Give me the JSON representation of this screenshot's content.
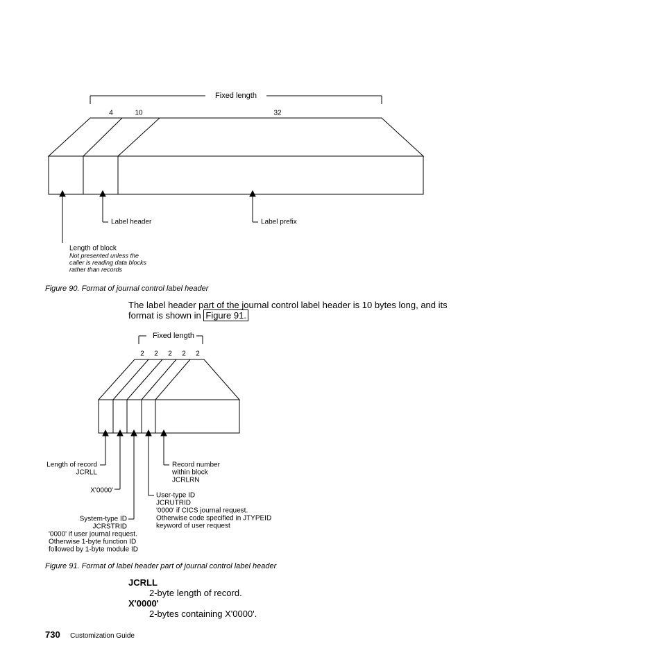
{
  "fig90": {
    "bracket_label": "Fixed length",
    "top_numbers": [
      "4",
      "10",
      "32"
    ],
    "label_header": "Label header",
    "label_prefix": "Label prefix",
    "length_of_block": "Length of block",
    "note1": "Not presented unless the",
    "note2": "caller is reading data blocks",
    "note3": "rather than records",
    "caption": "Figure 90. Format of journal control label header"
  },
  "para": {
    "line1_a": "The label header part of the journal control label header is 10 bytes long, and its",
    "line2_a": "format is shown in ",
    "line2_link": "Figure 91."
  },
  "fig91": {
    "bracket_label": "Fixed length",
    "top_numbers": [
      "2",
      "2",
      "2",
      "2",
      "2"
    ],
    "len_rec1": "Length of record",
    "len_rec2": "JCRLL",
    "xi": "X'0000'",
    "sys1": "System-type ID",
    "sys2": "JCRSTRID",
    "sys3": "'0000' if user journal request.",
    "sys4": "Otherwise 1-byte function ID",
    "sys5": "followed by 1-byte module ID",
    "usr1": "User-type ID",
    "usr2": "JCRUTRID",
    "usr3": "'0000' if CICS journal request.",
    "usr4": "Otherwise code specified in JTYPEID",
    "usr5": "keyword of user request",
    "rec1": "Record number",
    "rec2": "within block",
    "rec3": "JCRLRN",
    "caption": "Figure 91. Format of label header part of journal control label header"
  },
  "defs": {
    "dt1": "JCRLL",
    "dd1": "2-byte length of record.",
    "dt2": "X'0000'",
    "dd2": "2-bytes containing X'0000'."
  },
  "footer": {
    "pagenum": "730",
    "title": "Customization Guide"
  }
}
